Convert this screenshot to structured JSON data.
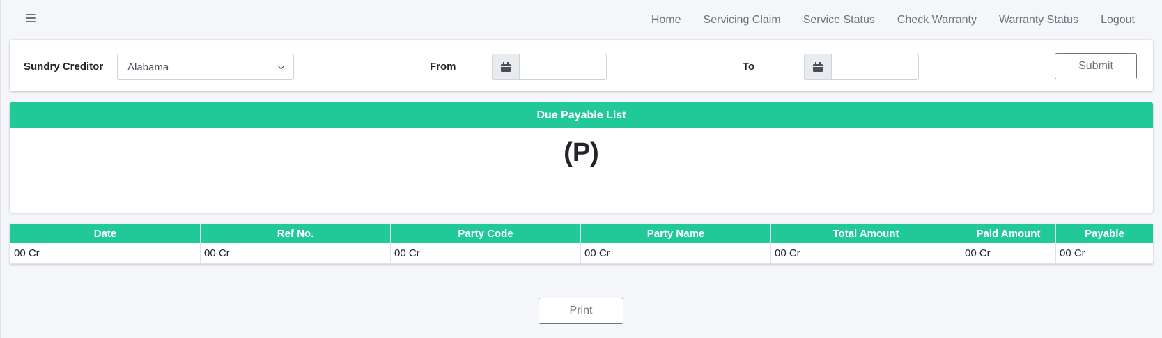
{
  "nav": {
    "menu_icon": "hamburger-icon",
    "links": [
      "Home",
      "Servicing Claim",
      "Service Status",
      "Check Warranty",
      "Warranty Status",
      "Logout"
    ]
  },
  "filter": {
    "creditor_label": "Sundry Creditor",
    "creditor_value": "Alabama",
    "from_label": "From",
    "to_label": "To",
    "from_value": "",
    "to_value": "",
    "calendar_icon": "calendar-icon",
    "submit_label": "Submit"
  },
  "list": {
    "title": "Due Payable List",
    "subtitle": "(P)"
  },
  "table": {
    "columns": [
      "Date",
      "Ref No.",
      "Party Code",
      "Party Name",
      "Total Amount",
      "Paid Amount",
      "Payable"
    ],
    "rows": [
      [
        "00 Cr",
        "00 Cr",
        "00 Cr",
        "00 Cr",
        "00 Cr",
        "00 Cr",
        "00 Cr"
      ]
    ]
  },
  "print_label": "Print",
  "colors": {
    "accent": "#20c997",
    "background": "#f4f6f9"
  }
}
